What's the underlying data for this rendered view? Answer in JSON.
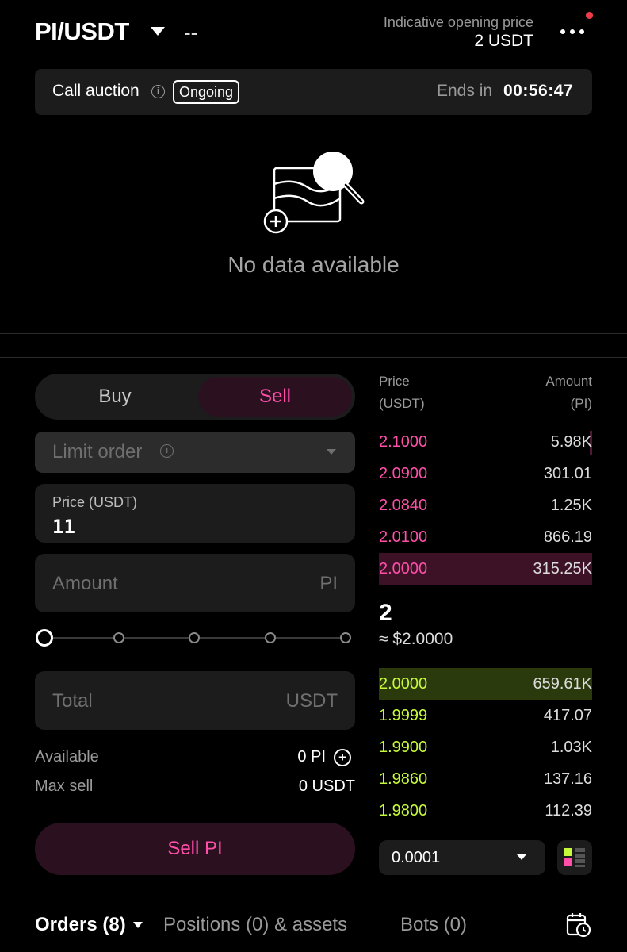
{
  "header": {
    "pair": "PI/USDT",
    "change": "--",
    "indicative_label": "Indicative opening price",
    "indicative_value": "2 USDT"
  },
  "auction": {
    "title": "Call auction",
    "status": "Ongoing",
    "ends_label": "Ends in",
    "ends_value": "00:56:47"
  },
  "empty_state": {
    "text": "No data available"
  },
  "order_form": {
    "buy_label": "Buy",
    "sell_label": "Sell",
    "order_type": "Limit order",
    "price_label": "Price (USDT)",
    "price_value": "11",
    "amount_placeholder": "Amount",
    "amount_unit": "PI",
    "slider_level": 0,
    "total_placeholder": "Total",
    "total_unit": "USDT",
    "available_label": "Available",
    "available_value": "0 PI",
    "max_sell_label": "Max sell",
    "max_sell_value": "0 USDT",
    "submit_label": "Sell PI"
  },
  "order_book": {
    "price_header": "Price",
    "price_unit": "(USDT)",
    "amount_header": "Amount",
    "amount_unit": "(PI)",
    "asks": [
      {
        "price": "2.1000",
        "amount": "5.98K"
      },
      {
        "price": "2.0900",
        "amount": "301.01"
      },
      {
        "price": "2.0840",
        "amount": "1.25K"
      },
      {
        "price": "2.0100",
        "amount": "866.19"
      },
      {
        "price": "2.0000",
        "amount": "315.25K"
      }
    ],
    "mid_price": "2",
    "mid_usd": "≈ $2.0000",
    "bids": [
      {
        "price": "2.0000",
        "amount": "659.61K"
      },
      {
        "price": "1.9999",
        "amount": "417.07"
      },
      {
        "price": "1.9900",
        "amount": "1.03K"
      },
      {
        "price": "1.9860",
        "amount": "137.16"
      },
      {
        "price": "1.9800",
        "amount": "112.39"
      }
    ],
    "precision": "0.0001"
  },
  "bottom_tabs": {
    "orders": "Orders (8)",
    "positions": "Positions (0) & assets",
    "bots": "Bots (0)"
  },
  "colors": {
    "sell_accent": "#ff4fa9",
    "buy_accent": "#c6f93a",
    "notification": "#ef3b4a"
  }
}
